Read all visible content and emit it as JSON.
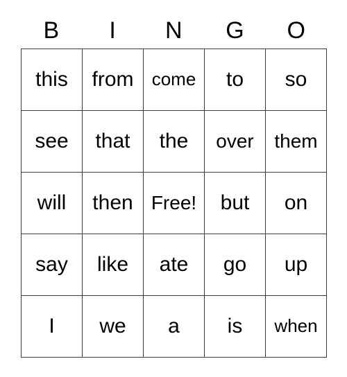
{
  "card": {
    "title": "BINGO",
    "free_space_label": "Free!",
    "colors": {
      "background": "#ffffff",
      "text": "#000000",
      "grid_line": "#3a3a3a"
    },
    "header": {
      "letters": [
        "B",
        "I",
        "N",
        "G",
        "O"
      ]
    },
    "grid": {
      "columns": 5,
      "rows": 5,
      "cells": [
        [
          {
            "text": "this",
            "free": false,
            "size": "normal"
          },
          {
            "text": "from",
            "free": false,
            "size": "normal"
          },
          {
            "text": "come",
            "free": false,
            "size": "small"
          },
          {
            "text": "to",
            "free": false,
            "size": "normal"
          },
          {
            "text": "so",
            "free": false,
            "size": "normal"
          }
        ],
        [
          {
            "text": "see",
            "free": false,
            "size": "normal"
          },
          {
            "text": "that",
            "free": false,
            "size": "normal"
          },
          {
            "text": "the",
            "free": false,
            "size": "normal"
          },
          {
            "text": "over",
            "free": false,
            "size": "medium"
          },
          {
            "text": "them",
            "free": false,
            "size": "medium"
          }
        ],
        [
          {
            "text": "will",
            "free": false,
            "size": "normal"
          },
          {
            "text": "then",
            "free": false,
            "size": "normal"
          },
          {
            "text": "Free!",
            "free": true,
            "size": "medium"
          },
          {
            "text": "but",
            "free": false,
            "size": "normal"
          },
          {
            "text": "on",
            "free": false,
            "size": "normal"
          }
        ],
        [
          {
            "text": "say",
            "free": false,
            "size": "normal"
          },
          {
            "text": "like",
            "free": false,
            "size": "normal"
          },
          {
            "text": "ate",
            "free": false,
            "size": "normal"
          },
          {
            "text": "go",
            "free": false,
            "size": "normal"
          },
          {
            "text": "up",
            "free": false,
            "size": "normal"
          }
        ],
        [
          {
            "text": "I",
            "free": false,
            "size": "normal"
          },
          {
            "text": "we",
            "free": false,
            "size": "normal"
          },
          {
            "text": "a",
            "free": false,
            "size": "normal"
          },
          {
            "text": "is",
            "free": false,
            "size": "normal"
          },
          {
            "text": "when",
            "free": false,
            "size": "small"
          }
        ]
      ]
    }
  }
}
